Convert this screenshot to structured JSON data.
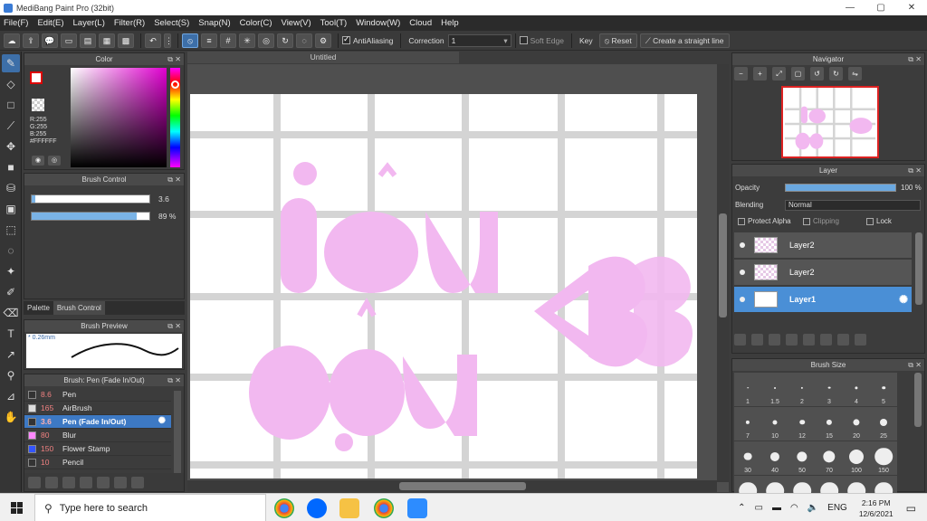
{
  "window": {
    "title": "MediBang Paint Pro (32bit)",
    "controls": [
      "—",
      "▢",
      "✕"
    ]
  },
  "menu": [
    "File(F)",
    "Edit(E)",
    "Layer(L)",
    "Filter(R)",
    "Select(S)",
    "Snap(N)",
    "Color(C)",
    "View(V)",
    "Tool(T)",
    "Window(W)",
    "Cloud",
    "Help"
  ],
  "toolbar": {
    "antialiasing_label": "AntiAliasing",
    "antialiasing_checked": true,
    "correction_label": "Correction",
    "correction_value": "1",
    "soft_edge_label": "Soft Edge",
    "soft_edge_checked": false,
    "key_label": "Key",
    "reset_label": "Reset",
    "straight_line_label": "Create a straight line"
  },
  "color_panel": {
    "title": "Color",
    "rgb_text": [
      "R:255",
      "G:255",
      "B:255",
      "#FFFFFF"
    ],
    "foreground": "#FFFFFF",
    "hue_accent": "#E000D0"
  },
  "brush_control": {
    "title": "Brush Control",
    "size_value": "3.6",
    "size_fraction": 0.03,
    "opacity_value": "89 %",
    "opacity_fraction": 0.89
  },
  "left_tabs": [
    "Palette",
    "Brush Control"
  ],
  "brush_preview": {
    "title": "Brush Preview",
    "size_label": "* 0.26mm"
  },
  "brush_list": {
    "title": "Brush: Pen (Fade In/Out)",
    "items": [
      {
        "size": "8.6",
        "name": "Pen",
        "color": "#333333",
        "selected": false
      },
      {
        "size": "165",
        "name": "AirBrush",
        "color": "#dddddd",
        "selected": false
      },
      {
        "size": "3.6",
        "name": "Pen (Fade In/Out)",
        "color": "#333333",
        "selected": true
      },
      {
        "size": "80",
        "name": "Blur",
        "color": "#ff88ff",
        "selected": false
      },
      {
        "size": "150",
        "name": "Flower Stamp",
        "color": "#3355ff",
        "selected": false
      },
      {
        "size": "10",
        "name": "Pencil",
        "color": "#333333",
        "selected": false
      }
    ]
  },
  "canvas": {
    "tab_title": "Untitled",
    "ink_color": "#F2B8F0"
  },
  "navigator": {
    "title": "Navigator"
  },
  "layer_panel": {
    "title": "Layer",
    "opacity_label": "Opacity",
    "opacity_value": "100 %",
    "blending_label": "Blending",
    "blending_value": "Normal",
    "protect_alpha_label": "Protect Alpha",
    "clipping_label": "Clipping",
    "lock_label": "Lock",
    "layers": [
      {
        "name": "Layer2",
        "selected": false
      },
      {
        "name": "Layer2",
        "selected": false
      },
      {
        "name": "Layer1",
        "selected": true
      }
    ]
  },
  "brush_size": {
    "title": "Brush Size",
    "sizes": [
      "1",
      "1.5",
      "2",
      "3",
      "4",
      "5",
      "7",
      "10",
      "12",
      "15",
      "20",
      "25",
      "30",
      "40",
      "50",
      "70",
      "100",
      "150",
      "",
      "",
      "",
      "",
      "",
      ""
    ]
  },
  "taskbar": {
    "search_placeholder": "Type here to search",
    "lang": "ENG",
    "time": "2:16 PM",
    "date": "12/6/2021"
  }
}
